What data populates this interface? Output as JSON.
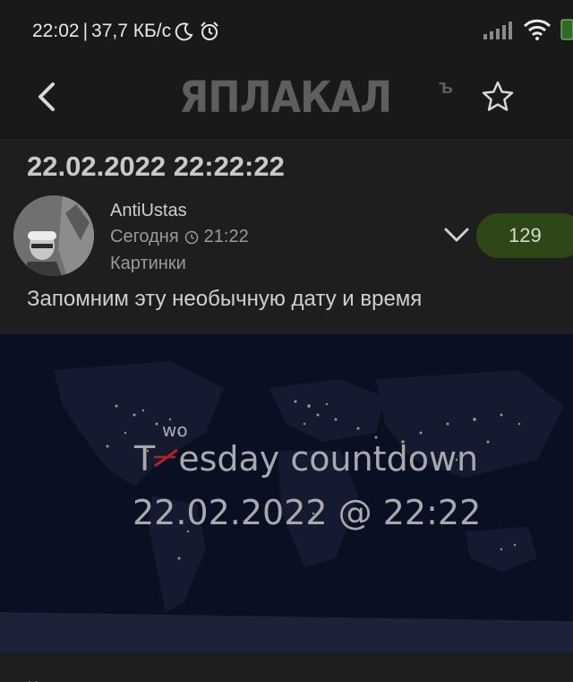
{
  "status_bar": {
    "time": "22:02",
    "separator": "|",
    "speed": "37,7 КБ/с",
    "icons": [
      "moon-icon",
      "alarm-icon",
      "signal-icon",
      "wifi-icon",
      "battery-icon"
    ]
  },
  "header": {
    "logo_text": "ЯПЛАКАЛ",
    "logo_suffix": "ъ",
    "back_icon": "chevron-left-icon",
    "favorite_icon": "star-outline-icon"
  },
  "post": {
    "title": "22.02.2022 22:22:22",
    "author": "AntiUstas",
    "date_label": "Сегодня",
    "time": "21:22",
    "category": "Картинки",
    "rating": "129",
    "text": "Запомним эту необычную дату и время",
    "image": {
      "line1_prefix": "T",
      "line1_rest": "esday countdown",
      "correction": "wo",
      "line2": "22.02.2022 @ 22:22"
    }
  },
  "comments": {
    "partial_label": "К"
  },
  "colors": {
    "background": "#1e1e1e",
    "header": "#191919",
    "rating_bg": "#2e4717",
    "image_bg": "#0a1024",
    "strike": "#b3202a"
  }
}
